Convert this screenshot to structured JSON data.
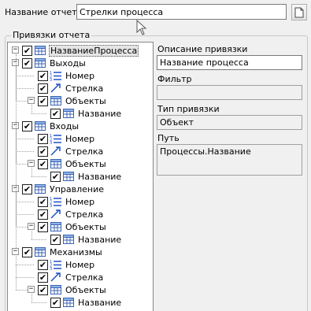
{
  "report": {
    "name_label": "Название отчета:",
    "name_value": "Стрелки процесса",
    "doc_icon": "document-icon"
  },
  "bindings": {
    "group_title": "Привязки отчета",
    "tree": {
      "root": "НазваниеПроцесса",
      "groups": [
        {
          "label": "Выходы",
          "children": [
            "Номер",
            "Стрелка",
            "Объекты"
          ],
          "leaf": "Название"
        },
        {
          "label": "Входы",
          "children": [
            "Номер",
            "Стрелка",
            "Объекты"
          ],
          "leaf": "Название"
        },
        {
          "label": "Управление",
          "children": [
            "Номер",
            "Стрелка",
            "Объекты"
          ],
          "leaf": "Название"
        },
        {
          "label": "Механизмы",
          "children": [
            "Номер",
            "Стрелка",
            "Объекты"
          ],
          "leaf": "Название"
        }
      ]
    }
  },
  "details": {
    "description_label": "Описание привязки",
    "description_value": "Название процесса",
    "filter_label": "Фильтр",
    "filter_value": "",
    "type_label": "Тип привязки",
    "type_value": "Объект",
    "path_label": "Путь",
    "path_value": "Процессы.Название"
  }
}
